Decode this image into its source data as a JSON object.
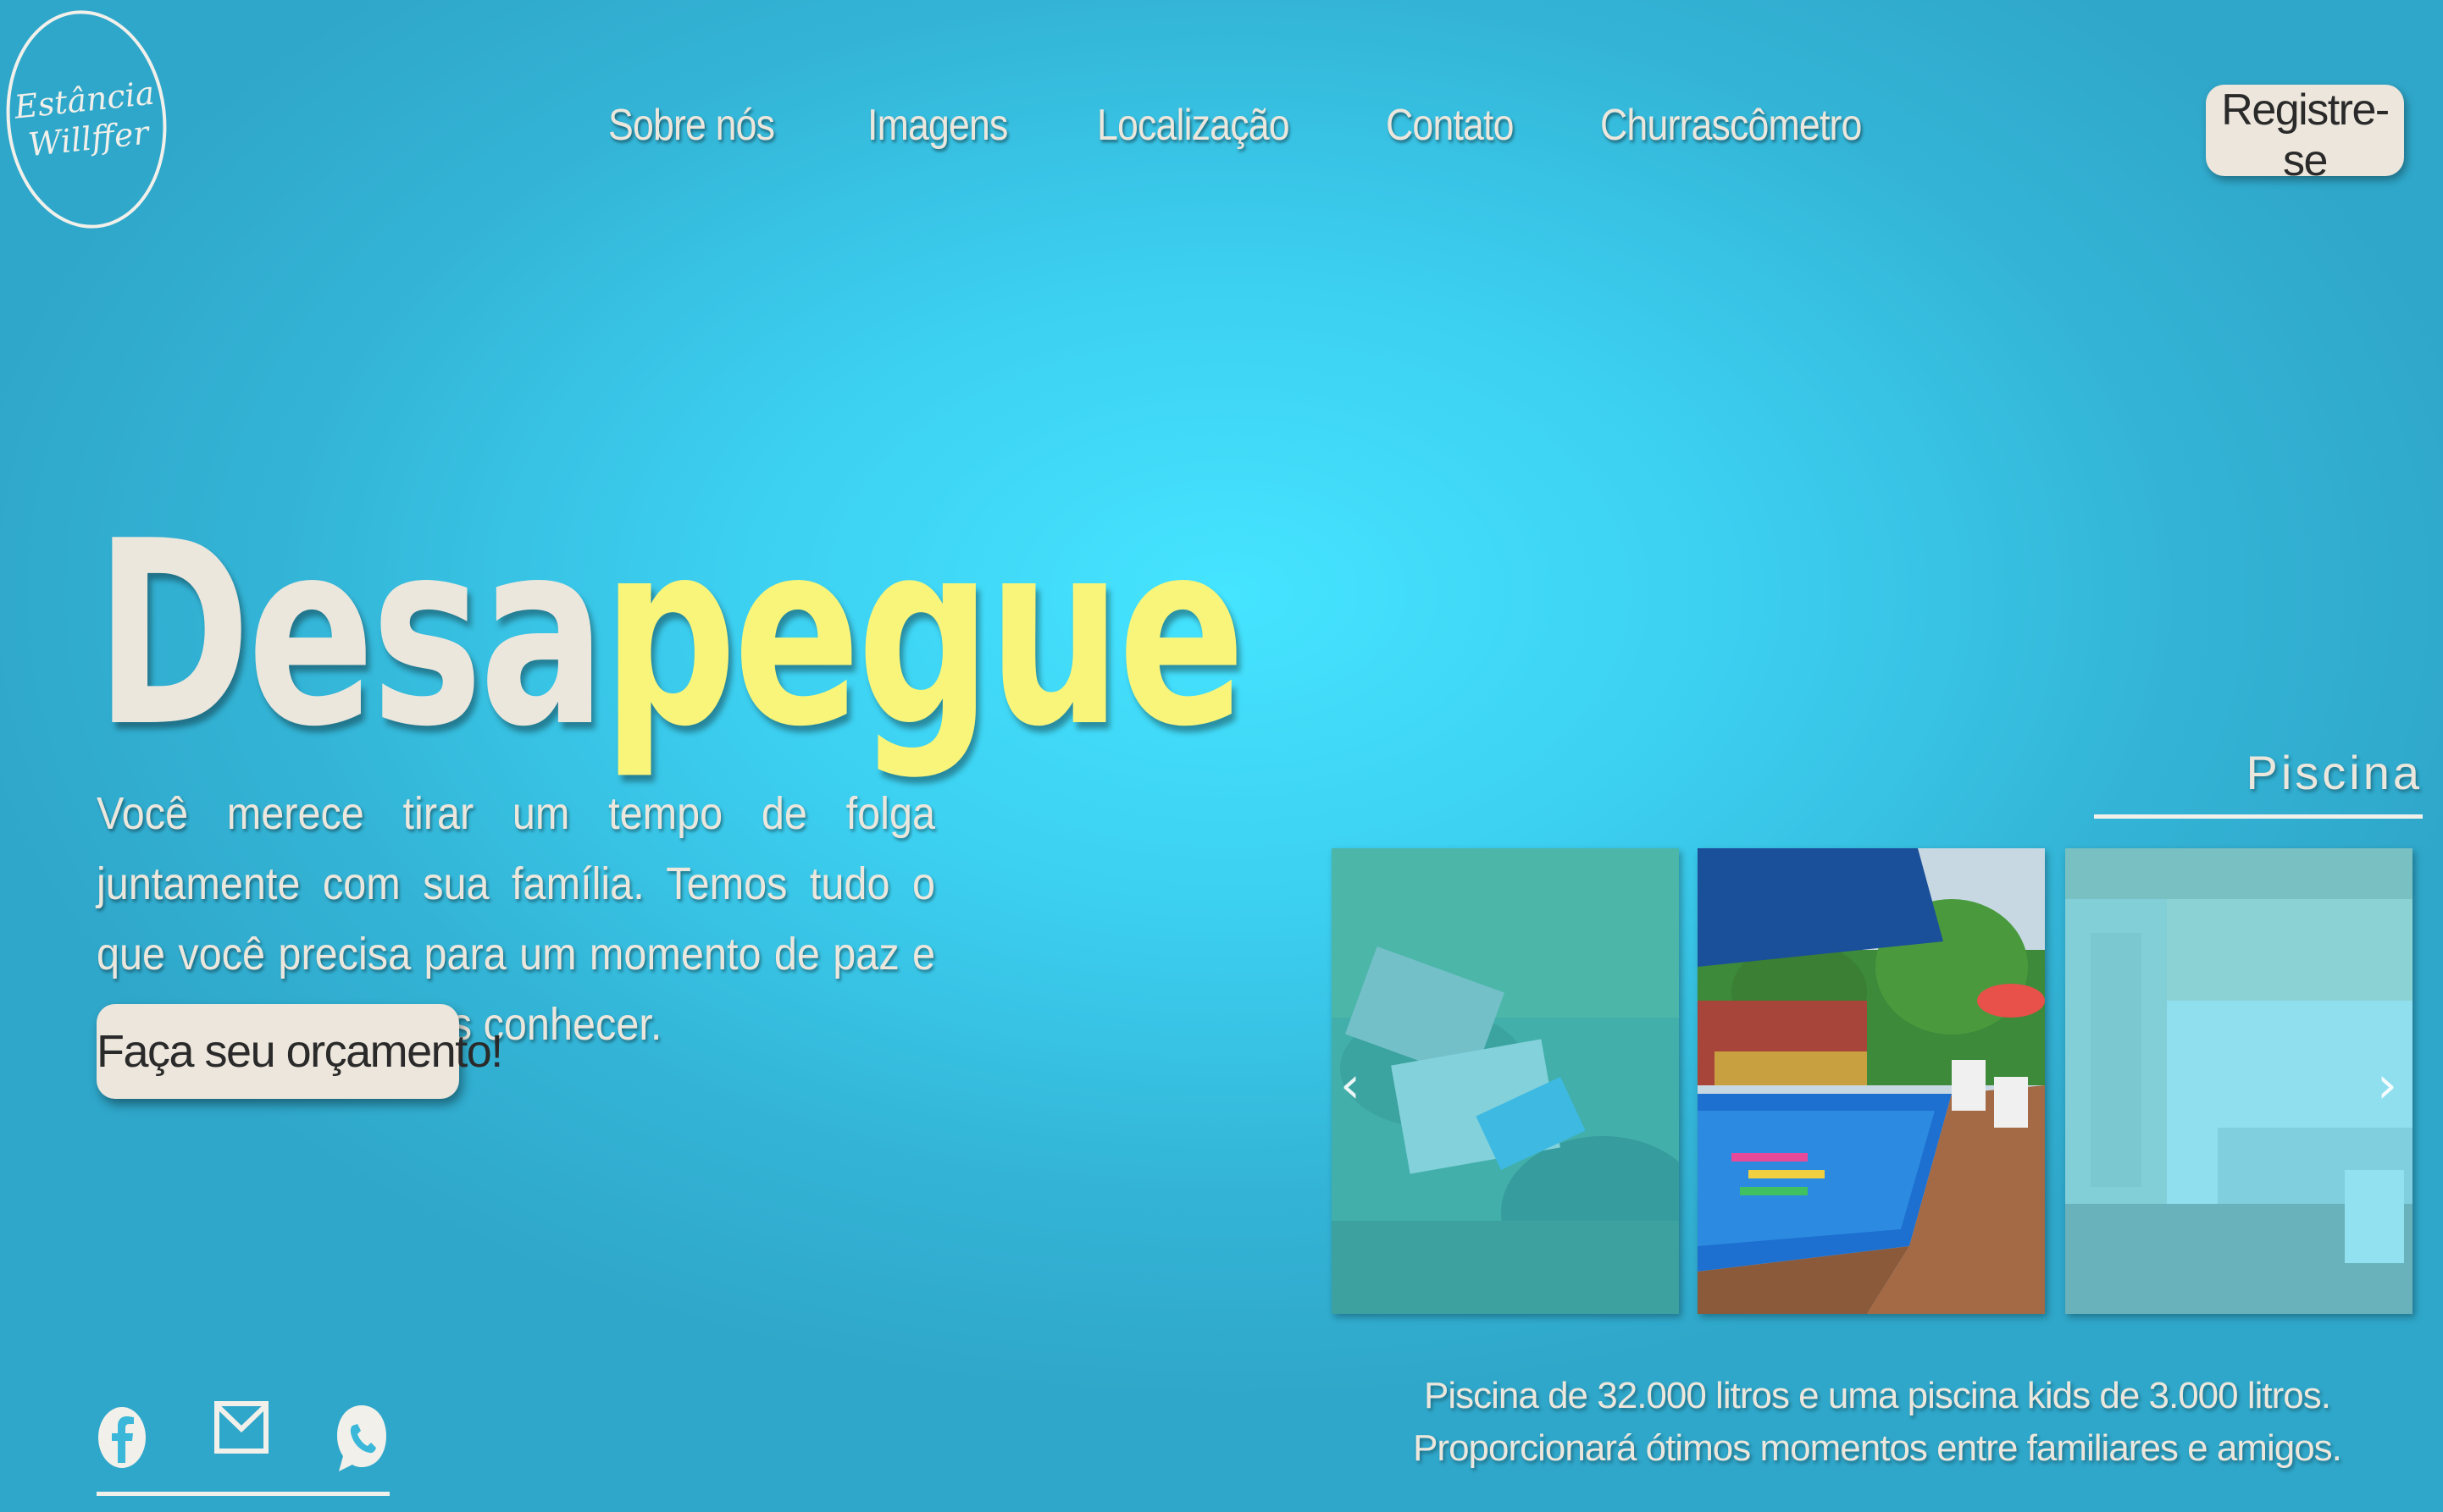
{
  "logo": {
    "line1": "Estância",
    "line2": "Willffer"
  },
  "nav": {
    "items": [
      {
        "label": "Sobre nós"
      },
      {
        "label": "Imagens"
      },
      {
        "label": "Localização"
      },
      {
        "label": "Contato"
      },
      {
        "label": "Churrascômetro"
      }
    ]
  },
  "header": {
    "register_label": "Registre-se"
  },
  "hero": {
    "title_part1": "Desa",
    "title_part2": "pegue",
    "text": "Você merece tirar um tempo de folga juntamente com sua família. Temos tudo o que você precisa para um momento de paz e diversão. Venha-nos conhecer.",
    "cta_label": "Faça seu orçamento!"
  },
  "social": {
    "icons": [
      "facebook-icon",
      "mail-icon",
      "whatsapp-icon"
    ]
  },
  "gallery": {
    "label": "Piscina",
    "caption_line1": "Piscina de 32.000 litros e uma piscina kids de 3.000 litros.",
    "caption_line2": "Proporcionará ótimos momentos entre familiares e amigos.",
    "prev_arrow": "‹",
    "next_arrow": "›"
  },
  "colors": {
    "accent_yellow": "#f9f57a",
    "text_cream": "#ece7dd",
    "button_bg": "#ece6dc",
    "background": "#3ccff0"
  }
}
